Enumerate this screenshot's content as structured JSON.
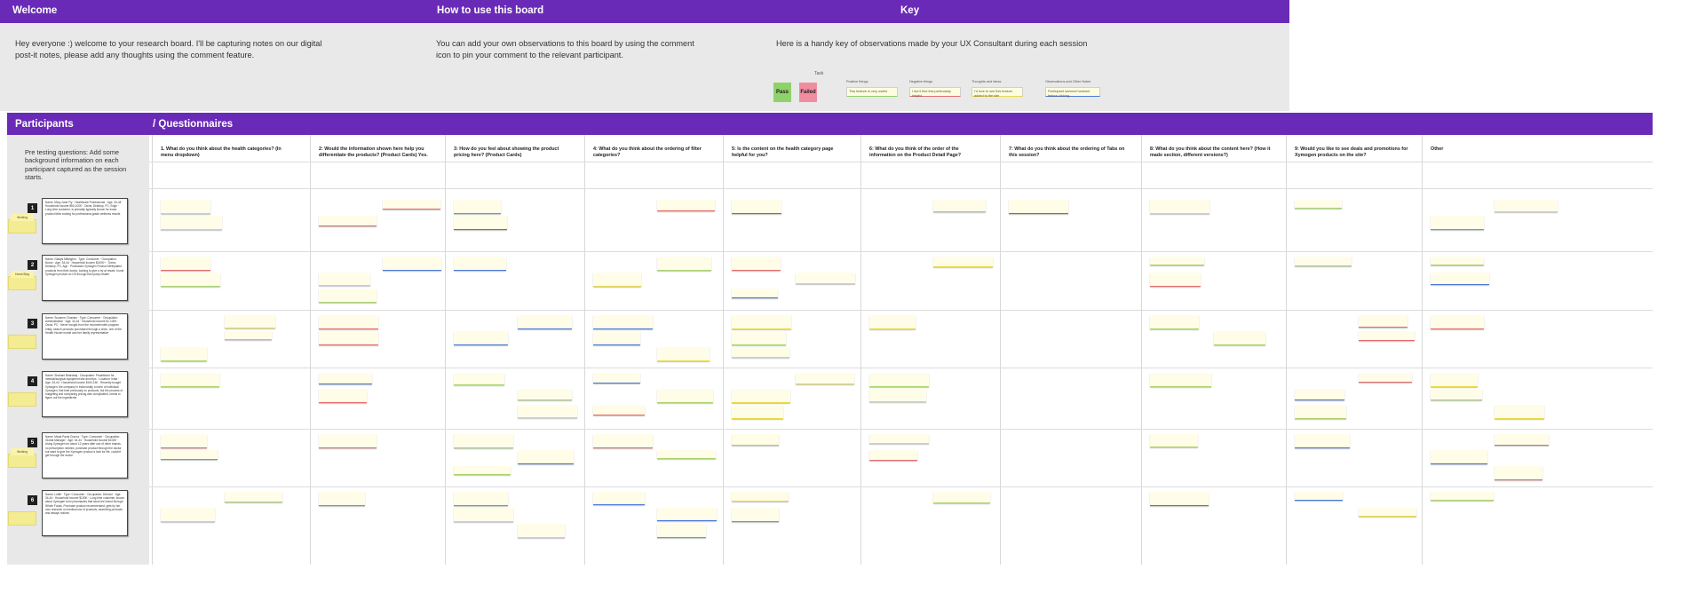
{
  "sections": {
    "welcome_title": "Welcome",
    "howto_title": "How to use this board",
    "key_title": "Key",
    "welcome_text": "Hey everyone :) welcome to your research board. I'll be capturing notes on our digital post-it notes, please add any thoughts using the comment feature.",
    "howto_text": "You can add your own observations to this board by using the comment icon to pin your comment to the relevant participant.",
    "key_text": "Here is a handy key of observations made by your UX Consultant during each session"
  },
  "key": {
    "task_label": "Task",
    "pass_label": "Pass",
    "failed_label": "Failed",
    "pass_color": "#8fd16a",
    "failed_color": "#f08ea0",
    "categories": [
      {
        "heading": "Positive things",
        "sample": "This feature is very useful",
        "color": "#8fd16a"
      },
      {
        "heading": "Negative things",
        "sample": "I don't find this particularly helpful",
        "color": "#e26d6d"
      },
      {
        "heading": "Thoughts and ideas",
        "sample": "I'd love to see this feature added to the site",
        "color": "#e8d94a"
      },
      {
        "heading": "Observations and Other Notes",
        "sample": "Participant seemed hesitant before clicking",
        "color": "#4a78d8"
      }
    ]
  },
  "participants_band": {
    "left_title": "Participants",
    "right_title": "/ Questionnaires"
  },
  "pre_testing": "Pre testing questions: Add some background information on each participant captured as the session starts.",
  "questions": [
    "1. What do you think about the health categories? (In menu dropdown)",
    "2: Would the information shown here help you differentiate the products? (Product Cards) Yes.",
    "3: How do you feel about showing the product pricing here? (Product Cards)",
    "4: What do you think about the ordering of filter categories?",
    "5: Is the content on the health category page helpful for you?",
    "6: What do you think of the order of the information on the Product Detail Page?",
    "7: What do you think about the ordering of Tabs on this session?",
    "8: What do you think about the content here? (How it made section, different versions?)",
    "9: Would you like to see deals and promotions for Xymogen products on the site?",
    "Other"
  ],
  "participants": [
    {
      "number": "1",
      "label": "Working",
      "card": "Name: Mary-Jane Fly · Healthcare Professional · Age: 34-44 · Household income $50-100K · Owns: Desktop, PC, Edge · Long time customer, is primarily typically known for exact product titles looking for professional-grade wellness results"
    },
    {
      "number": "2",
      "label": "Home Blog",
      "card": "Name: Gladys Millington · Type: Consumer · Occupation: Nurse · Age: 34-44 · Household income $100K+ · Owns: Desktop, PC, App · Purchased Xymogen Product Methylated products from their doctor, looking to give a try at resale, found Xymogen product on US through third party retailer"
    },
    {
      "number": "3",
      "label": "",
      "card": "Name: Suzanne Chardan · Type: Consumer · Occupation: Administrative · Age: 34-44 · Household income $1-100K · Owns: PC · Never bought from the recommended program entity, search products purchased through a clinic, one of the Health Hunter model and her family representative"
    },
    {
      "number": "4",
      "label": "",
      "card": "Name: Shahani Bhardwaj · Occupation: Practitioner for medical/surgical equipment site and trips · Location: India · Age: 34-44 · Household income $100-150 · Recently bought Xymogen, the company in India totally a niche of individual Xymogen, first time previously on products, but the process of budgeting and comparing pricing was complicated, needs to figure out the ingredients"
    },
    {
      "number": "5",
      "label": "Working",
      "card": "Name: Maria Paola Gurroa · Type: Consumer · Occupation: Global Manager · Age: 34-44 · Household income $100K · Using Xymogen for about 12 years after use of other brands, no prescription needed, purchase product through the doctor but want to give the Xymogen product a look for life, couldn't get through the doctor"
    },
    {
      "number": "6",
      "label": "",
      "card": "Name: Lottie · Type: Consumer · Occupation: Director · Age: 34-44 · Household income $100K · Long time customer, knows about Xymogen from pharmacies that stock the brand through Whole Foods, Purchase product recommended; gets by her own research on medical use of products, searching products and always notices"
    }
  ]
}
